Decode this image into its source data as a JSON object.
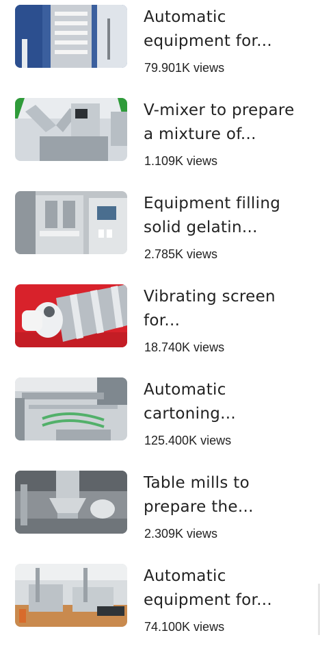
{
  "videos": [
    {
      "title_line1": "Automatic",
      "title_line2": "equipment for...",
      "views": "79.901K views",
      "thumb_icon": "vacuum-loader-machine-thumbnail"
    },
    {
      "title_line1": "V-mixer to prepare",
      "title_line2": "a mixture of...",
      "views": "1.109K views",
      "thumb_icon": "v-mixer-machine-thumbnail"
    },
    {
      "title_line1": "Equipment filling",
      "title_line2": "solid gelatin...",
      "views": "2.785K views",
      "thumb_icon": "capsule-filling-machine-thumbnail"
    },
    {
      "title_line1": "Vibrating screen",
      "title_line2": "for...",
      "views": "18.740K views",
      "thumb_icon": "vibrating-screen-thumbnail"
    },
    {
      "title_line1": "Automatic",
      "title_line2": "cartoning...",
      "views": "125.400K views",
      "thumb_icon": "cartoning-machine-thumbnail"
    },
    {
      "title_line1": "Table mills to",
      "title_line2": "prepare the...",
      "views": "2.309K views",
      "thumb_icon": "table-mill-thumbnail"
    },
    {
      "title_line1": "Automatic",
      "title_line2": "equipment for...",
      "views": "74.100K views",
      "thumb_icon": "packaging-line-thumbnail"
    }
  ],
  "colors": {
    "text": "#222222",
    "background": "#ffffff"
  }
}
